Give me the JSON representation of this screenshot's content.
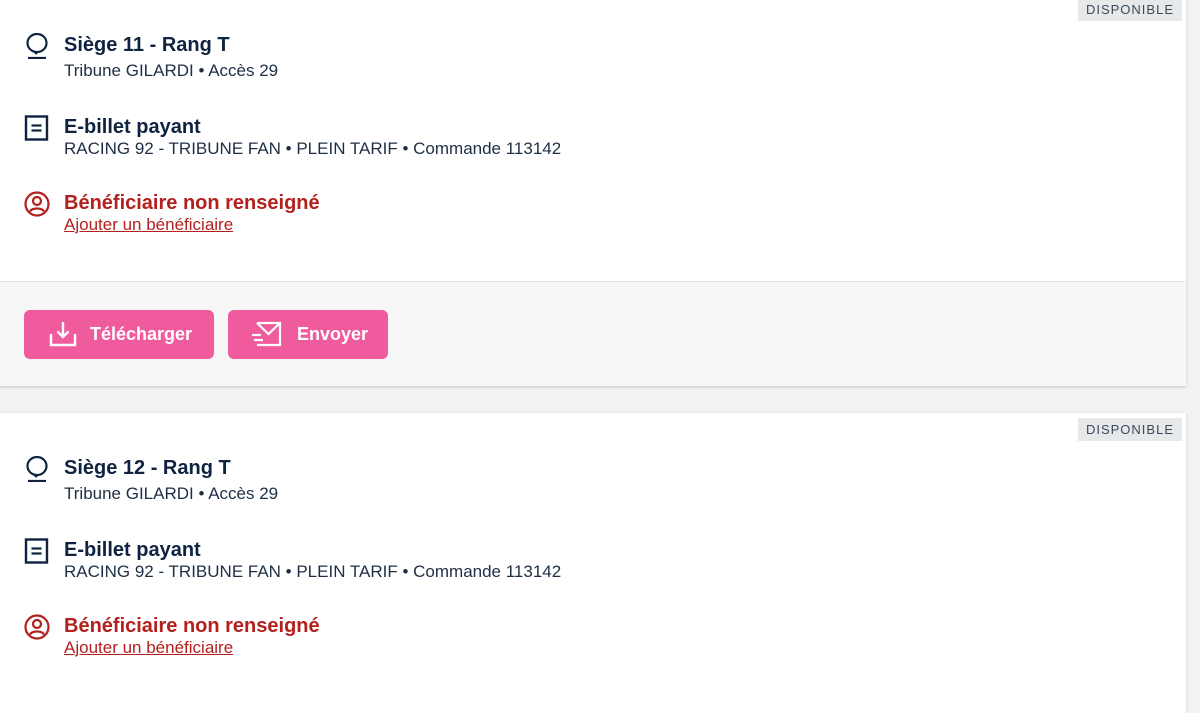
{
  "colors": {
    "accent_pink": "#ef5b9c",
    "error_red": "#b3211f",
    "text_navy": "#0f2340",
    "badge_bg": "#e6e8ea"
  },
  "tickets": [
    {
      "status": "DISPONIBLE",
      "seat": {
        "title": "Siège 11 - Rang T",
        "subtitle": "Tribune GILARDI • Accès 29",
        "icon": "map-pin-icon"
      },
      "ticket": {
        "title": "E-billet payant",
        "subtitle": "RACING 92 - TRIBUNE FAN • PLEIN TARIF • Commande 113142",
        "icon": "document-icon"
      },
      "beneficiary": {
        "title": "Bénéficiaire non renseigné",
        "link": "Ajouter un bénéficiaire",
        "icon": "user-circle-icon"
      },
      "actions": {
        "download": "Télécharger",
        "send": "Envoyer"
      }
    },
    {
      "status": "DISPONIBLE",
      "seat": {
        "title": "Siège 12 - Rang T",
        "subtitle": "Tribune GILARDI • Accès 29",
        "icon": "map-pin-icon"
      },
      "ticket": {
        "title": "E-billet payant",
        "subtitle": "RACING 92 - TRIBUNE FAN • PLEIN TARIF • Commande 113142",
        "icon": "document-icon"
      },
      "beneficiary": {
        "title": "Bénéficiaire non renseigné",
        "link": "Ajouter un bénéficiaire",
        "icon": "user-circle-icon"
      }
    }
  ]
}
